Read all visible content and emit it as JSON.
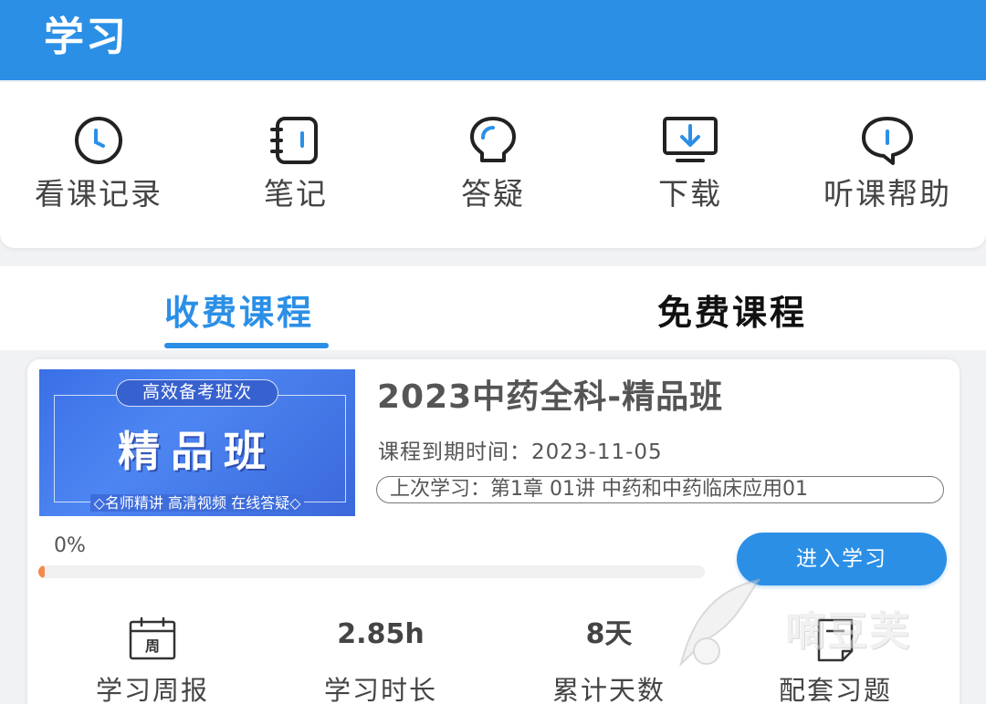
{
  "header": {
    "title": "学习"
  },
  "quick_actions": [
    {
      "label": "看课记录",
      "icon": "clock-icon"
    },
    {
      "label": "笔记",
      "icon": "notebook-icon"
    },
    {
      "label": "答疑",
      "icon": "qa-bulb-icon"
    },
    {
      "label": "下载",
      "icon": "download-icon"
    },
    {
      "label": "听课帮助",
      "icon": "help-chat-icon"
    }
  ],
  "tabs": [
    {
      "label": "收费课程",
      "active": true
    },
    {
      "label": "免费课程",
      "active": false
    }
  ],
  "course": {
    "cover": {
      "top_text": "高效备考班次",
      "main_text": "精品班",
      "sub_text": "◇名师精讲 高清视频 在线答疑◇"
    },
    "title": "2023中药全科-精品班",
    "expire_text": "课程到期时间：2023-11-05",
    "last_study_text": "上次学习：第1章 01讲 中药和中药临床应用01",
    "progress_text": "0%",
    "progress_value": 0,
    "enter_button": "进入学习",
    "stats": [
      {
        "value": "周",
        "label": "学习周报",
        "icon": "weekly-calendar-icon"
      },
      {
        "value": "2.85h",
        "label": "学习时长"
      },
      {
        "value": "8天",
        "label": "累计天数"
      },
      {
        "value": "",
        "label": "配套习题",
        "icon": "exercise-doc-icon"
      }
    ]
  },
  "watermark": {
    "text": "嘀豆芙"
  },
  "colors": {
    "brand_blue": "#2b8fe6",
    "progress_orange": "#f28a4e",
    "background": "#f1f2f4"
  }
}
